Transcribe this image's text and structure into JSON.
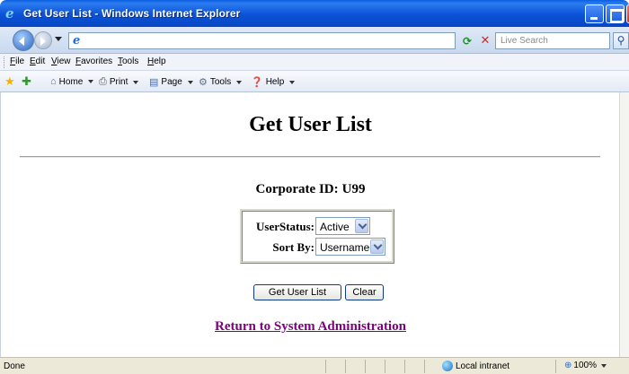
{
  "window": {
    "title": "Get User List - Windows Internet Explorer"
  },
  "toolbar": {
    "address_value": "",
    "search_placeholder": "Live Search"
  },
  "menu": [
    "File",
    "Edit",
    "View",
    "Favorites",
    "Tools",
    "Help"
  ],
  "command_bar": {
    "home": "Home",
    "print": "Print",
    "page": "Page",
    "tools": "Tools",
    "help": "Help"
  },
  "page": {
    "title": "Get User List",
    "corporate_label": "Corporate ID:",
    "corporate_id": "U99",
    "filters": {
      "status_label": "UserStatus:",
      "status_value": "Active",
      "sort_label": "Sort By:",
      "sort_value": "Username"
    },
    "get_button": "Get User List",
    "clear_button": "Clear",
    "return_link": "Return to System Administration"
  },
  "status": {
    "text": "Done",
    "zone": "Local intranet",
    "zoom": "100%"
  },
  "colors": {
    "titlebar": "#0b52d6",
    "visited_link": "#800080",
    "status_bar": "#ece9d8"
  }
}
